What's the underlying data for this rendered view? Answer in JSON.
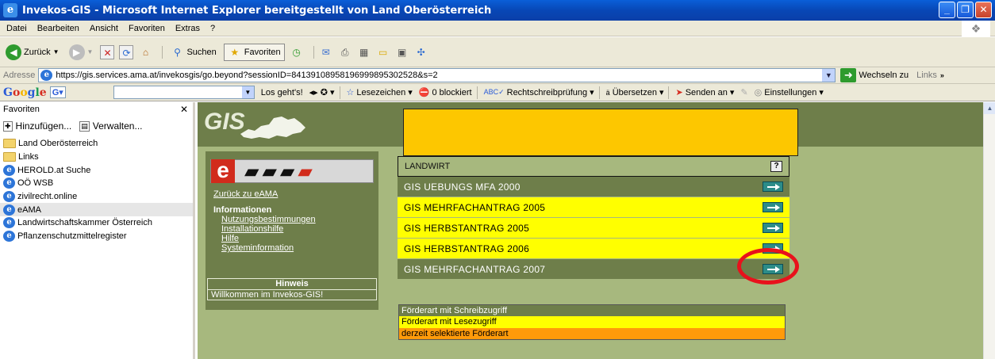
{
  "window": {
    "title": "Invekos-GIS - Microsoft Internet Explorer bereitgestellt von Land Oberösterreich"
  },
  "menu": [
    "Datei",
    "Bearbeiten",
    "Ansicht",
    "Favoriten",
    "Extras",
    "?"
  ],
  "toolbar": {
    "back": "Zurück",
    "search": "Suchen",
    "favorites": "Favoriten"
  },
  "address": {
    "label": "Adresse",
    "url": "https://gis.services.ama.at/invekosgis/go.beyond?sessionID=84139108958196999895302528&s=2",
    "go": "Wechseln zu",
    "links": "Links"
  },
  "google": {
    "go_label": "Los geht's!",
    "bookmarks": "Lesezeichen",
    "blocked": "0 blockiert",
    "spellcheck": "Rechtschreibprüfung",
    "translate": "Übersetzen",
    "send": "Senden an",
    "settings": "Einstellungen"
  },
  "favorites": {
    "header": "Favoriten",
    "add": "Hinzufügen...",
    "manage": "Verwalten...",
    "items": [
      {
        "label": "Land Oberösterreich",
        "type": "folder"
      },
      {
        "label": "Links",
        "type": "folder"
      },
      {
        "label": "HEROLD.at Suche",
        "type": "link"
      },
      {
        "label": "OÖ WSB",
        "type": "link"
      },
      {
        "label": "zivilrecht.online",
        "type": "link"
      },
      {
        "label": "eAMA",
        "type": "link",
        "selected": true
      },
      {
        "label": "Landwirtschaftskammer Österreich",
        "type": "link"
      },
      {
        "label": "Pflanzenschutzmittelregister",
        "type": "link"
      }
    ]
  },
  "page": {
    "logo_text": "GIS",
    "back_link": "Zurück zu eAMA",
    "info_heading": "Informationen",
    "info_links": [
      "Nutzungsbestimmungen",
      "Installationshilfe",
      "Hilfe",
      "Systeminformation"
    ],
    "notice_heading": "Hinweis",
    "notice_text": "Willkommen im Invekos-GIS!",
    "section_label": "LANDWIRT",
    "help_glyph": "?",
    "rows": [
      {
        "label": "GIS UEBUNGS MFA 2000",
        "style": "green"
      },
      {
        "label": "GIS MEHRFACHANTRAG 2005",
        "style": "yellow"
      },
      {
        "label": "GIS HERBSTANTRAG 2005",
        "style": "yellow"
      },
      {
        "label": "GIS HERBSTANTRAG 2006",
        "style": "yellow"
      },
      {
        "label": "GIS MEHRFACHANTRAG 2007",
        "style": "green"
      }
    ],
    "legend": [
      {
        "label": "Förderart mit Schreibzugriff",
        "style": "green"
      },
      {
        "label": "Förderart mit Lesezugriff",
        "style": "yellow"
      },
      {
        "label": "derzeit selektierte Förderart",
        "style": "orange"
      }
    ]
  }
}
